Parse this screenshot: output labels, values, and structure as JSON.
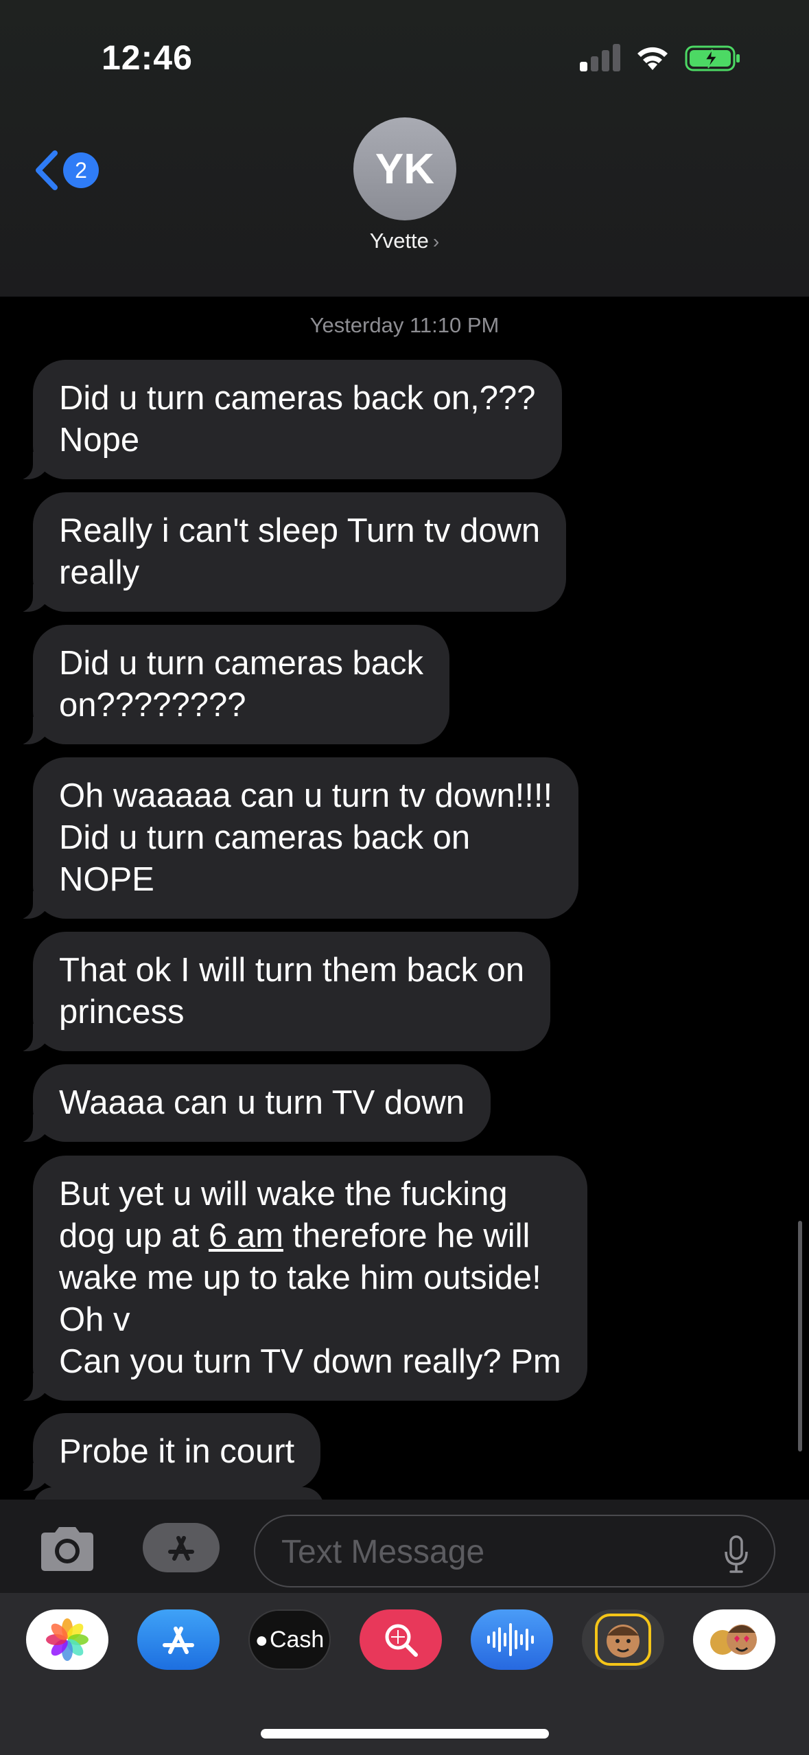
{
  "status_bar": {
    "time": "12:46"
  },
  "header": {
    "back_badge": "2",
    "avatar_initials": "YK",
    "contact_name": "Yvette",
    "contact_chevron": "›"
  },
  "conversation": {
    "timestamp": "Yesterday 11:10 PM",
    "messages": [
      {
        "text": "Did u turn cameras back on,???\nNope"
      },
      {
        "text": "Really i can't sleep Turn tv down\nreally"
      },
      {
        "text": "Did u turn cameras back\non????????"
      },
      {
        "text": "Oh waaaaa can u turn tv down!!!!\nDid u turn cameras  back on\nNOPE"
      },
      {
        "text": "That ok I will turn them back on\nprincess"
      },
      {
        "text": "Waaaa can u turn TV down"
      },
      {
        "text_before": "But yet u will wake the fucking\ndog up at ",
        "link": "6 am",
        "text_after": " therefore he will\nwake me up to take him outside!\nOh v\nCan you turn TV down really? Pm"
      },
      {
        "text": "Probe it in court"
      }
    ]
  },
  "input": {
    "placeholder": "Text Message"
  },
  "app_drawer": {
    "apps": [
      {
        "icon": "photos-icon"
      },
      {
        "icon": "app-store-icon"
      },
      {
        "icon": "apple-cash-icon",
        "label": "Cash"
      },
      {
        "icon": "image-search-icon"
      },
      {
        "icon": "audio-message-icon"
      },
      {
        "icon": "memoji-icon"
      },
      {
        "icon": "animoji-stickers-icon"
      }
    ]
  },
  "colors": {
    "bubble_gray": "#262629",
    "accent_blue": "#2f7cf6",
    "battery_green": "#4cd964"
  }
}
